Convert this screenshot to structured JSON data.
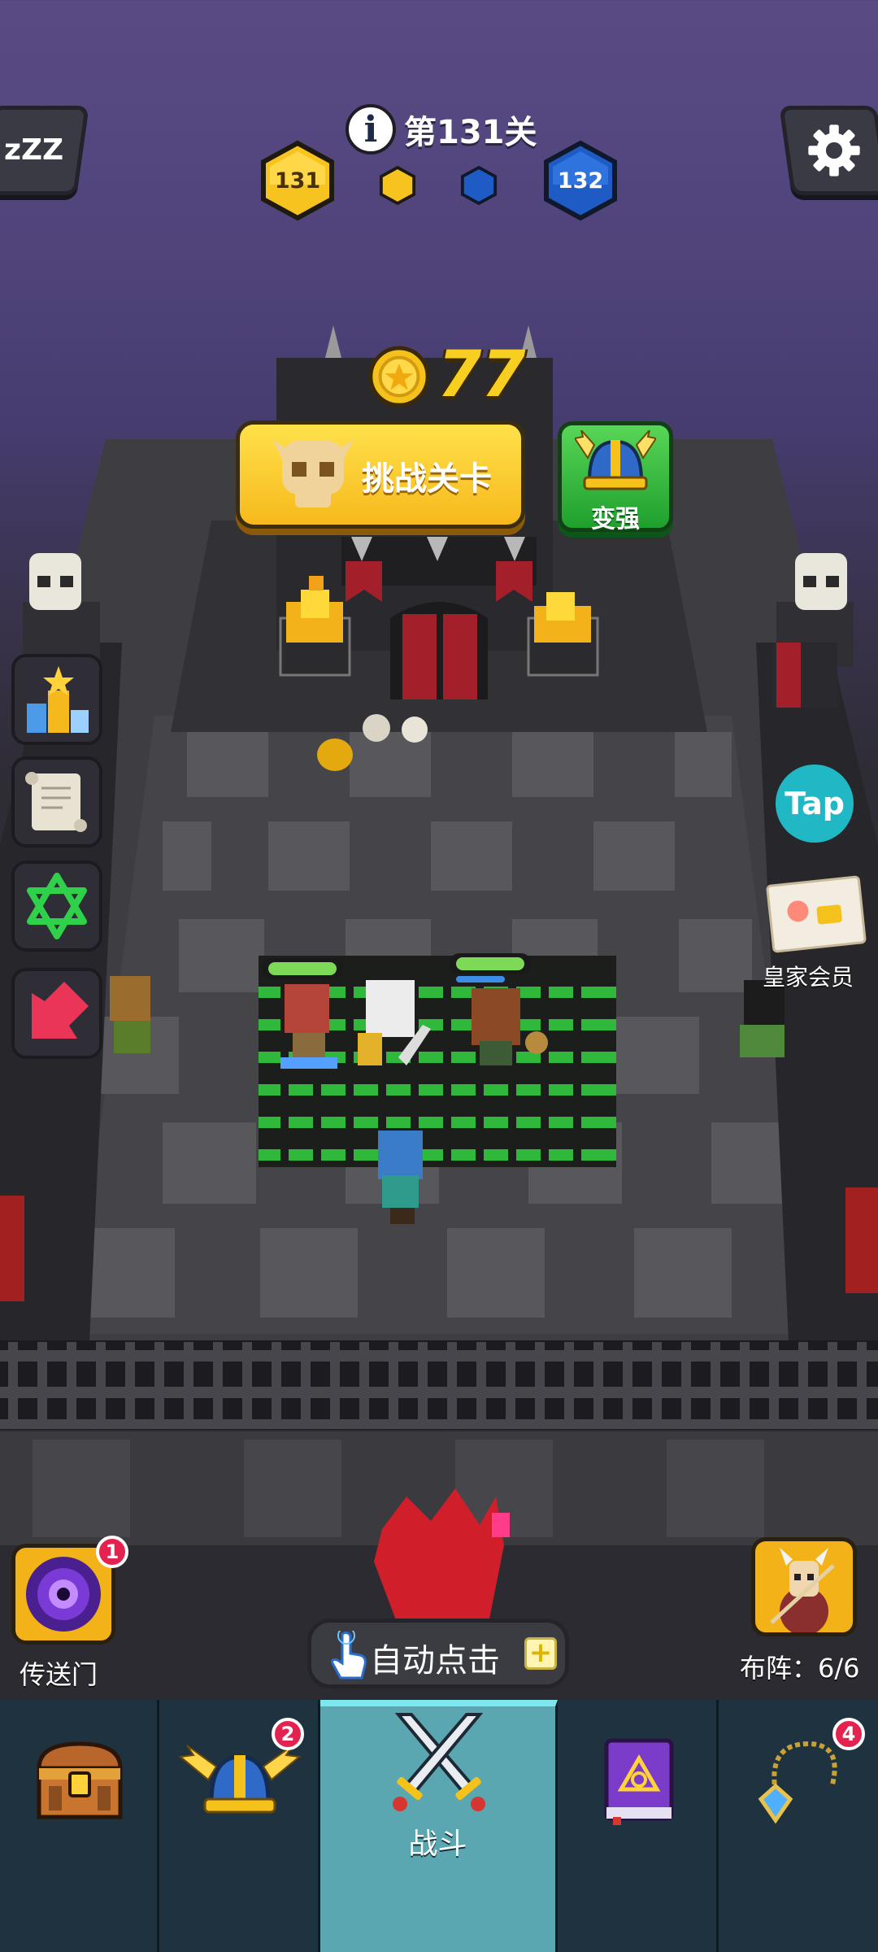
{
  "hud": {
    "sleep_icon_text": "zZZ",
    "level_title": "第131关",
    "level_current": "131",
    "level_next": "132",
    "gold_amount": "77"
  },
  "buttons": {
    "challenge": "挑战关卡",
    "strengthen": "变强",
    "tap_label": "Tap",
    "vip_label": "皇家会员",
    "portal_label": "传送门",
    "portal_badge": "1",
    "lineup_label": "布阵：6/6",
    "auto_click": "自动点击",
    "auto_click_plus": "+"
  },
  "nav": {
    "tabs": [
      {
        "id": "chest",
        "label": "",
        "badge": ""
      },
      {
        "id": "helmet",
        "label": "",
        "badge": "2"
      },
      {
        "id": "fight",
        "label": "战斗",
        "badge": ""
      },
      {
        "id": "spellbook",
        "label": "",
        "badge": ""
      },
      {
        "id": "amulet",
        "label": "",
        "badge": "4"
      }
    ]
  },
  "colors": {
    "accent_yellow": "#f7c31e",
    "accent_blue": "#1f5bc4",
    "accent_green": "#2fb83b",
    "badge_red": "#e3224f",
    "tab_active": "#5aa7b1"
  },
  "icons": [
    "sleep-icon",
    "info-icon",
    "settings-gear-icon",
    "gold-coin-icon",
    "skull-icon",
    "viking-helmet-icon",
    "trophy-icon",
    "scroll-icon",
    "hexagram-icon",
    "red-arrow-icon",
    "portal-icon",
    "lineup-hero-icon",
    "hand-pointer-icon",
    "treasure-chest-icon",
    "crossed-swords-icon",
    "spellbook-icon",
    "amulet-icon"
  ]
}
